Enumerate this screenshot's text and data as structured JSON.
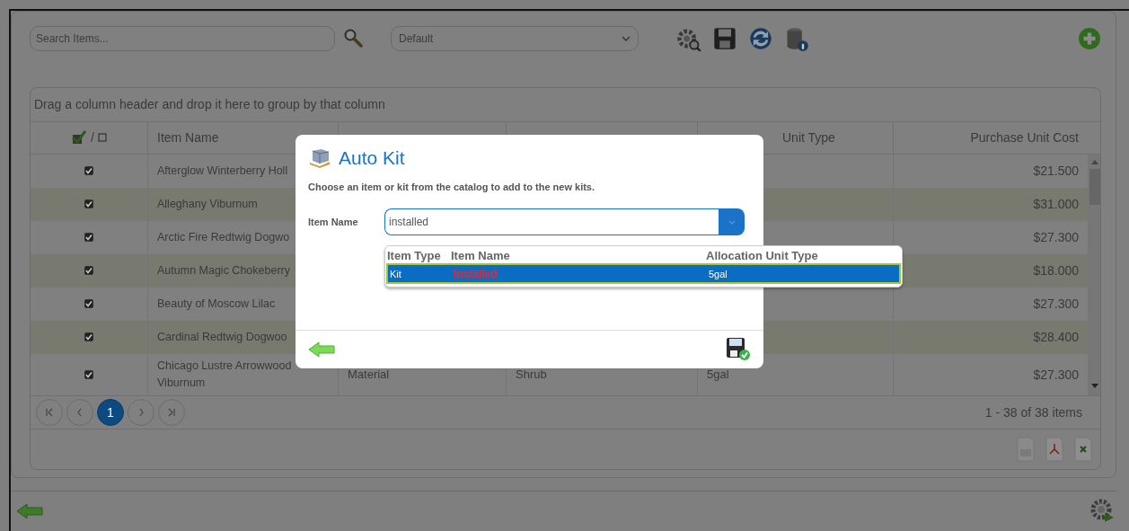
{
  "toolbar": {
    "search": {
      "placeholder": "Search Items..."
    },
    "view_select": {
      "value": "Default"
    }
  },
  "group_panel": {
    "text": "Drag a column header and drop it here to group by that column"
  },
  "grid": {
    "select_header": {
      "separator": "/"
    },
    "header": {
      "item_name": "Item Name",
      "column_5": "Unit Type",
      "purchase_unit_cost": "Purchase Unit Cost"
    },
    "rows": [
      {
        "checked": true,
        "item_name": "Afterglow Winterberry Holl",
        "cost": "$21.500"
      },
      {
        "checked": true,
        "item_name": "Alleghany Viburnum",
        "cost": "$31.000"
      },
      {
        "checked": true,
        "item_name": "Arctic Fire Redtwig Dogwo",
        "cost": "$27.300"
      },
      {
        "checked": true,
        "item_name": "Autumn Magic Chokeberry",
        "cost": "$18.000"
      },
      {
        "checked": true,
        "item_name": "Beauty of Moscow Lilac",
        "cost": "$27.300"
      },
      {
        "checked": true,
        "item_name": "Cardinal Redtwig Dogwoo",
        "cost": "$28.400"
      },
      {
        "checked": true,
        "item_name": "Chicago Lustre Arrowwood Viburnum",
        "column_3": "Material",
        "column_4": "Shrub",
        "column_5": "5gal",
        "cost": "$27.300"
      }
    ],
    "pager": {
      "pages": [
        {
          "label": "1",
          "selected": true
        }
      ],
      "summary": "1 - 38 of 38 items"
    }
  },
  "dialog": {
    "title": "Auto Kit",
    "instruction": "Choose an item or kit from the catalog to add to the new kits.",
    "field_label": "Item Name",
    "field_value": "installed",
    "suggestions": {
      "columns": [
        "Item Type",
        "Item Name",
        "Allocation Unit Type"
      ],
      "rows": [
        {
          "item_type": "Kit",
          "item_name": "Installed",
          "allocation_unit_type": "5gal",
          "selected": true
        }
      ]
    }
  }
}
